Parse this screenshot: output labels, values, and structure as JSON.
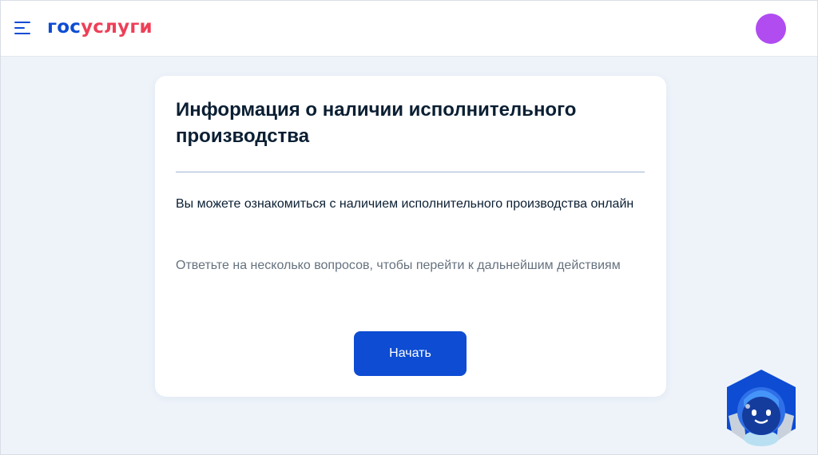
{
  "header": {
    "logo_part1": "гос",
    "logo_part2": "услуги",
    "menu_icon": "hamburger-menu-icon",
    "avatar_color": "#b04cf0"
  },
  "card": {
    "title": "Информация о наличии исполнительного производства",
    "lead": "Вы можете ознакомиться с наличием исполнительного производства онлайн",
    "hint": "Ответьте на несколько вопросов, чтобы перейти к дальнейшим действиям",
    "start_button_label": "Начать"
  },
  "assistant": {
    "icon": "robot-assistant-icon"
  },
  "colors": {
    "brand_blue": "#0d4cd3",
    "brand_red": "#ee3f58",
    "page_background": "#eef3fa"
  }
}
